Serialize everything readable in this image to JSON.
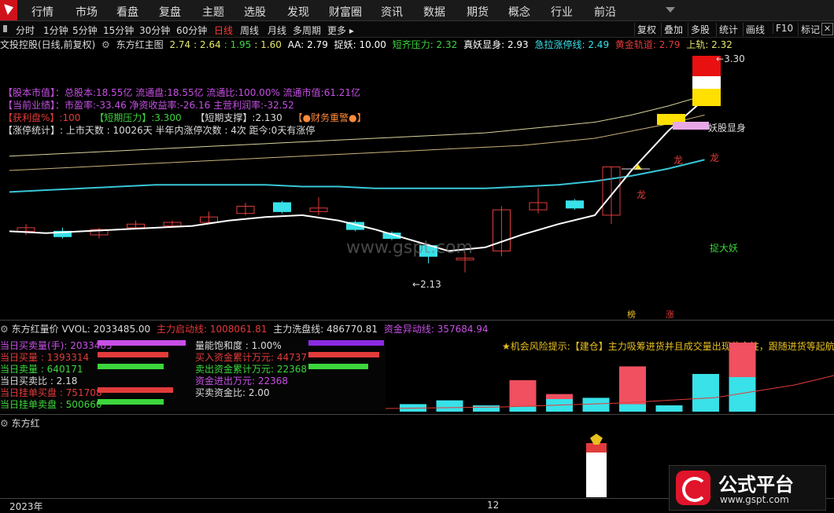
{
  "menu": {
    "items": [
      "行情",
      "市场",
      "看盘",
      "复盘",
      "主题",
      "选股",
      "发现",
      "财富圈",
      "资讯",
      "数据",
      "期货",
      "概念",
      "行业",
      "前沿"
    ]
  },
  "toolbar": {
    "periods": [
      "分时",
      "1分钟",
      "5分钟",
      "15分钟",
      "30分钟",
      "60分钟",
      "日线",
      "周线",
      "月线",
      "多周期",
      "更多"
    ],
    "active_period": "日线",
    "right_buttons": [
      "复权",
      "叠加",
      "多股",
      "统计",
      "画线",
      "F10",
      "标记"
    ]
  },
  "title_bar": {
    "stock": "文投控股(日线,前复权)",
    "indicator": "东方红主图",
    "values": [
      {
        "text": "2.74",
        "color": "#e8e86a"
      },
      {
        "text": "2.64",
        "color": "#e8e86a"
      },
      {
        "text": "1.95",
        "color": "#3cd63c"
      },
      {
        "text": "1.60",
        "color": "#e8e86a"
      },
      {
        "text": "AA: 2.79",
        "color": "#ffffff"
      },
      {
        "text": "捉妖: 10.00",
        "color": "#ffffff"
      },
      {
        "text": "短齐压力: 2.32",
        "color": "#3cd63c"
      },
      {
        "text": "真妖显身: 2.93",
        "color": "#ffffff"
      },
      {
        "text": "急拉涨停线: 2.49",
        "color": "#39e1e8"
      },
      {
        "text": "黄金轨道: 2.79",
        "color": "#e23b3b"
      },
      {
        "text": "上轨: 2.32",
        "color": "#e8e86a"
      }
    ]
  },
  "info": {
    "line1": "【股本市值】：总股本:18.55亿  流通盘:18.55亿  流通比:100.00%  流通市值:61.21亿",
    "line2": "【当前业绩】：市盈率:-33.46  净资收益率:-26.16  主营利润率:-32.52",
    "line3_a": "【获利盘%】:100",
    "line3_b": "【短期压力】:3.300",
    "line3_c": "【短期支撑】:2.130",
    "line3_d": "【●财务重警●】",
    "line4": "【涨停统计】: 上市天数 : 10026天  半年内涨停次数 : 4次   距今:0天有涨停"
  },
  "chart_labels": {
    "high_price": "3.30",
    "low_price": "2.13",
    "yao_show": "妖股显身",
    "long": "龙",
    "zhuo_da_yao": "捉大妖",
    "watermark_text": "www.gspt.com",
    "bang": "榜",
    "zhang": "涨"
  },
  "chart_data": {
    "type": "candlestick",
    "candles": [
      {
        "o": 2.36,
        "c": 2.38,
        "h": 2.4,
        "l": 2.34
      },
      {
        "o": 2.36,
        "c": 2.33,
        "h": 2.38,
        "l": 2.32
      },
      {
        "o": 2.34,
        "c": 2.37,
        "h": 2.38,
        "l": 2.32
      },
      {
        "o": 2.38,
        "c": 2.4,
        "h": 2.42,
        "l": 2.37
      },
      {
        "o": 2.39,
        "c": 2.41,
        "h": 2.42,
        "l": 2.38
      },
      {
        "o": 2.41,
        "c": 2.44,
        "h": 2.47,
        "l": 2.4
      },
      {
        "o": 2.46,
        "c": 2.5,
        "h": 2.52,
        "l": 2.45
      },
      {
        "o": 2.52,
        "c": 2.47,
        "h": 2.53,
        "l": 2.46
      },
      {
        "o": 2.47,
        "c": 2.49,
        "h": 2.55,
        "l": 2.45
      },
      {
        "o": 2.41,
        "c": 2.37,
        "h": 2.42,
        "l": 2.36
      },
      {
        "o": 2.35,
        "c": 2.32,
        "h": 2.36,
        "l": 2.31
      },
      {
        "o": 2.28,
        "c": 2.22,
        "h": 2.29,
        "l": 2.18
      },
      {
        "o": 2.2,
        "c": 2.21,
        "h": 2.24,
        "l": 2.13
      },
      {
        "o": 2.25,
        "c": 2.48,
        "h": 2.5,
        "l": 2.22
      },
      {
        "o": 2.48,
        "c": 2.52,
        "h": 2.6,
        "l": 2.46
      },
      {
        "o": 2.53,
        "c": 2.49,
        "h": 2.54,
        "l": 2.48
      },
      {
        "o": 2.45,
        "c": 2.72,
        "h": 2.72,
        "l": 2.4
      }
    ],
    "ylim": [
      2.05,
      3.35
    ],
    "white_line": [
      2.36,
      2.35,
      2.36,
      2.37,
      2.38,
      2.39,
      2.42,
      2.44,
      2.45,
      2.42,
      2.37,
      2.31,
      2.25,
      2.27,
      2.34,
      2.4,
      2.45,
      2.7,
      2.92,
      3.1
    ],
    "cyan_line": [
      2.58,
      2.59,
      2.6,
      2.61,
      2.62,
      2.62,
      2.62,
      2.62,
      2.61,
      2.61,
      2.6,
      2.6,
      2.6,
      2.6,
      2.61,
      2.62,
      2.64,
      2.67,
      2.71,
      2.76
    ],
    "yellow_line1": [
      2.78,
      2.79,
      2.8,
      2.81,
      2.82,
      2.83,
      2.84,
      2.85,
      2.86,
      2.87,
      2.88,
      2.89,
      2.9,
      2.91,
      2.93,
      2.95,
      2.97,
      3.01,
      3.06,
      3.12
    ],
    "yellow_line2": [
      2.7,
      2.71,
      2.72,
      2.73,
      2.74,
      2.75,
      2.76,
      2.77,
      2.78,
      2.79,
      2.8,
      2.81,
      2.82,
      2.83,
      2.84,
      2.86,
      2.88,
      2.92,
      2.96,
      3.01
    ]
  },
  "vol": {
    "title": "东方红量价",
    "vvol": "VVOL: 2033485.00",
    "zhuli_qidong": "主力启动线: 1008061.81",
    "zhuli_xipan": "主力洗盘线: 486770.81",
    "zijin_yidong": "资金异动线: 357684.94",
    "left_labels": [
      {
        "text": "当日买卖量(手): 2033485",
        "color": "#c84fe6"
      },
      {
        "text": "当日买量 : 1393314",
        "color": "#e23b3b"
      },
      {
        "text": "当日卖量 : 640171",
        "color": "#3cd63c"
      },
      {
        "text": "当日买卖比 : 2.18",
        "color": "#dddddd"
      },
      {
        "text": "当日挂单买盘 : 751708",
        "color": "#e23b3b"
      },
      {
        "text": "当日挂单卖盘 : 500660",
        "color": "#3cd63c"
      }
    ],
    "mid_labels": [
      {
        "text": "量能饱和度 : 1.00%",
        "color": "#dddddd"
      },
      {
        "text": "买入资金累计万元: 44737",
        "color": "#e23b3b"
      },
      {
        "text": "卖出资金累计万元: 22368",
        "color": "#3cd63c"
      },
      {
        "text": "资金进出万元: 22368",
        "color": "#c84fe6"
      },
      {
        "text": "买卖资金比: 2.00",
        "color": "#dddddd"
      }
    ],
    "alert": "★机会风险提示:【建仓】主力吸筹进货并且成交量出现黄金柱，跟随进货等起航",
    "bars": [
      {
        "cyan": 0.12,
        "red": 0
      },
      {
        "cyan": 0.18,
        "red": 0
      },
      {
        "cyan": 0.1,
        "red": 0
      },
      {
        "cyan": 0.08,
        "red": 0.42
      },
      {
        "cyan": 0.2,
        "red": 0.08
      },
      {
        "cyan": 0.22,
        "red": 0
      },
      {
        "cyan": 0.12,
        "red": 0.6
      },
      {
        "cyan": 0.1,
        "red": 0
      },
      {
        "cyan": 0.6,
        "red": 0
      },
      {
        "cyan": 0.55,
        "red": 0.55
      }
    ]
  },
  "third": {
    "title": "东方红"
  },
  "axis": {
    "year": "2023年",
    "month": "12"
  },
  "brand": {
    "name": "公式平台",
    "url": "www.gspt.com"
  }
}
